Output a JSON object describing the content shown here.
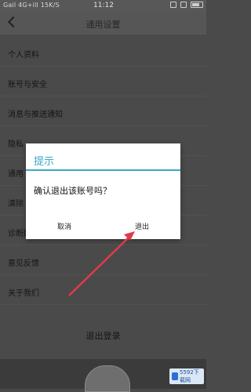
{
  "status_bar": {
    "left_text": "Gail 4G+ill 15K/S",
    "time": "11:12"
  },
  "header": {
    "title": "通用设置"
  },
  "menu_items": [
    "个人资料",
    "账号与安全",
    "消息与推送通知",
    "隐私",
    "通用",
    "清除",
    "诊断网络",
    "意见反馈",
    "关于我们"
  ],
  "logout_label": "退出登录",
  "dialog": {
    "title": "提示",
    "message": "确认退出该账号吗？",
    "cancel_label": "取消",
    "confirm_label": "退出"
  },
  "watermark_text": "5592下载网",
  "colors": {
    "accent": "#3aa8c9",
    "arrow": "#e03a4a"
  }
}
